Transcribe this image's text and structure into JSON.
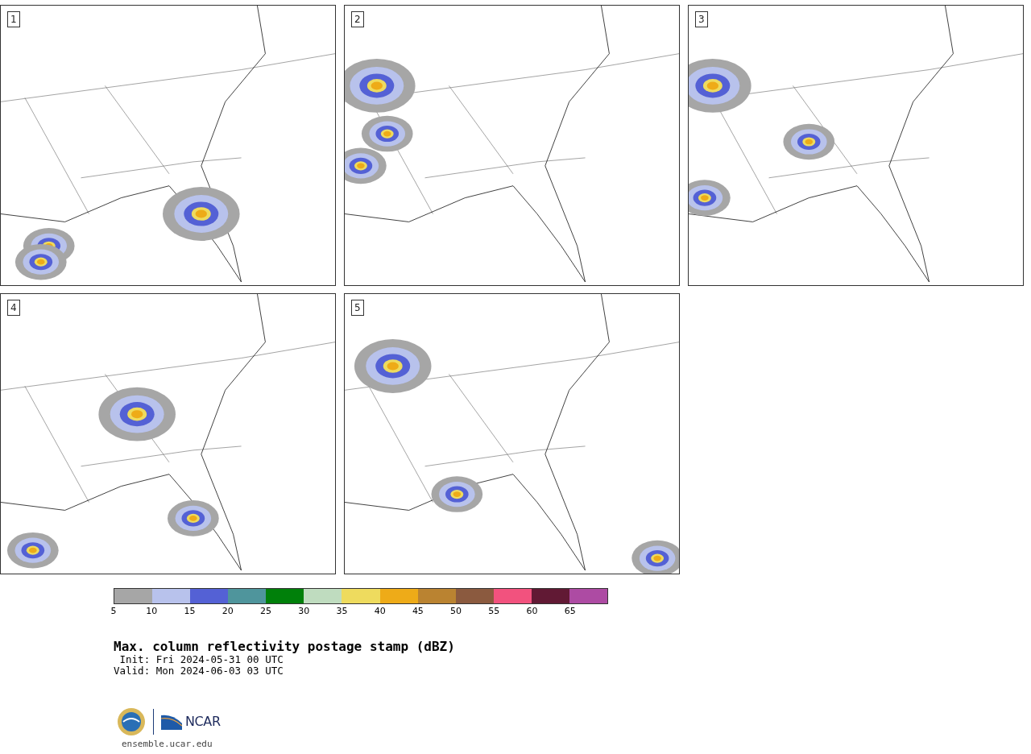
{
  "panels": [
    {
      "label": "1"
    },
    {
      "label": "2"
    },
    {
      "label": "3"
    },
    {
      "label": "4"
    },
    {
      "label": "5"
    }
  ],
  "colorbar": {
    "segments": [
      {
        "color": "#a6a6a6",
        "tick": "5"
      },
      {
        "color": "#b8c2ec",
        "tick": "10"
      },
      {
        "color": "#5461d5",
        "tick": "15"
      },
      {
        "color": "#4f959c",
        "tick": "20"
      },
      {
        "color": "#00800a",
        "tick": "25"
      },
      {
        "color": "#bfdcbf",
        "tick": "30"
      },
      {
        "color": "#eedb5e",
        "tick": "35"
      },
      {
        "color": "#eeab18",
        "tick": "40"
      },
      {
        "color": "#ba8331",
        "tick": "45"
      },
      {
        "color": "#8b5a3f",
        "tick": "50"
      },
      {
        "color": "#f2527e",
        "tick": "55"
      },
      {
        "color": "#611934",
        "tick": "60"
      },
      {
        "color": "#ad4ba3",
        "tick": "65"
      }
    ]
  },
  "title": "Max. column reflectivity postage stamp (dBZ)",
  "init": " Init: Fri 2024-05-31 00 UTC",
  "valid": "Valid: Mon 2024-06-03 03 UTC",
  "footer": {
    "logo_text": "NCAR",
    "url": "ensemble.ucar.edu"
  }
}
